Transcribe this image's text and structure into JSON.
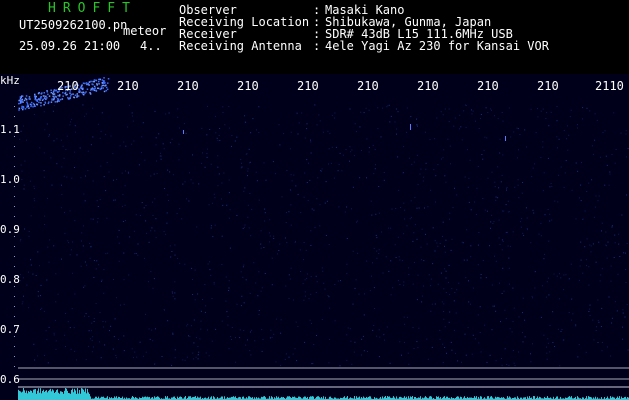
{
  "header": {
    "app_title": "HROFFT",
    "file_name": "UT2509262100.pn",
    "tag": "meteor",
    "date": "25.09.26 21:00",
    "count": "4..",
    "info": [
      {
        "key": "Observer",
        "sep": ":",
        "value": "Masaki Kano"
      },
      {
        "key": "Receiving Location",
        "sep": ":",
        "value": "Shibukawa, Gunma, Japan"
      },
      {
        "key": "Receiver",
        "sep": ":",
        "value": "SDR# 43dB L15 111.6MHz USB"
      },
      {
        "key": "Receiving Antenna",
        "sep": ":",
        "value": "4ele Yagi Az 230 for Kansai VOR"
      }
    ]
  },
  "axes": {
    "y_unit": "kHz",
    "y_ticks": [
      "1.1",
      "1.0",
      "0.9",
      "0.8",
      "0.7",
      "0.6"
    ],
    "x_ticks": [
      "210",
      "210",
      "210",
      "210",
      "210",
      "210",
      "210",
      "210",
      "210",
      "2110"
    ]
  },
  "colors": {
    "background": "#000000",
    "plot_bg": "#00001a",
    "title_green": "#29c429",
    "echo_blue": "#3a6cff",
    "spectrum_cyan": "#33c8d8"
  }
}
